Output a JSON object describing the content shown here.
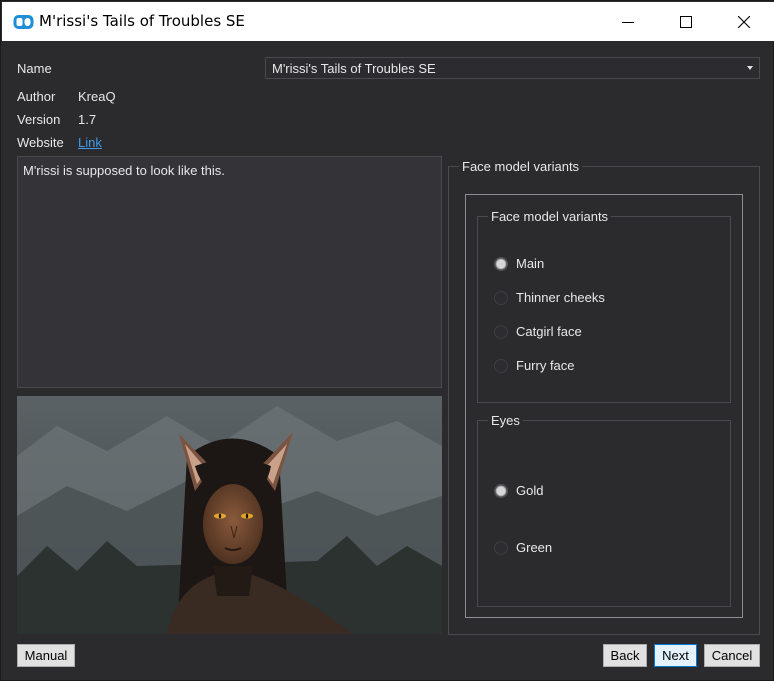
{
  "window": {
    "title": "M'rissi's Tails of Troubles SE"
  },
  "info": {
    "name_label": "Name",
    "name_value": "M'rissi's Tails of Troubles SE",
    "author_label": "Author",
    "author_value": "KreaQ",
    "version_label": "Version",
    "version_value": "1.7",
    "website_label": "Website",
    "website_link": "Link"
  },
  "description": "M'rissi is supposed to look like this.",
  "options": {
    "outer_title": "Face model variants",
    "groups": [
      {
        "title": "Face model variants",
        "items": [
          {
            "label": "Main",
            "checked": true
          },
          {
            "label": "Thinner cheeks",
            "checked": false
          },
          {
            "label": "Catgirl face",
            "checked": false
          },
          {
            "label": "Furry face",
            "checked": false
          }
        ]
      },
      {
        "title": "Eyes",
        "items": [
          {
            "label": "Gold",
            "checked": true
          },
          {
            "label": "Green",
            "checked": false
          }
        ]
      }
    ]
  },
  "buttons": {
    "manual": "Manual",
    "back": "Back",
    "next": "Next",
    "cancel": "Cancel"
  },
  "colors": {
    "background": "#2b2b2e",
    "link": "#3f9be6",
    "titlebar": "#ffffff"
  }
}
